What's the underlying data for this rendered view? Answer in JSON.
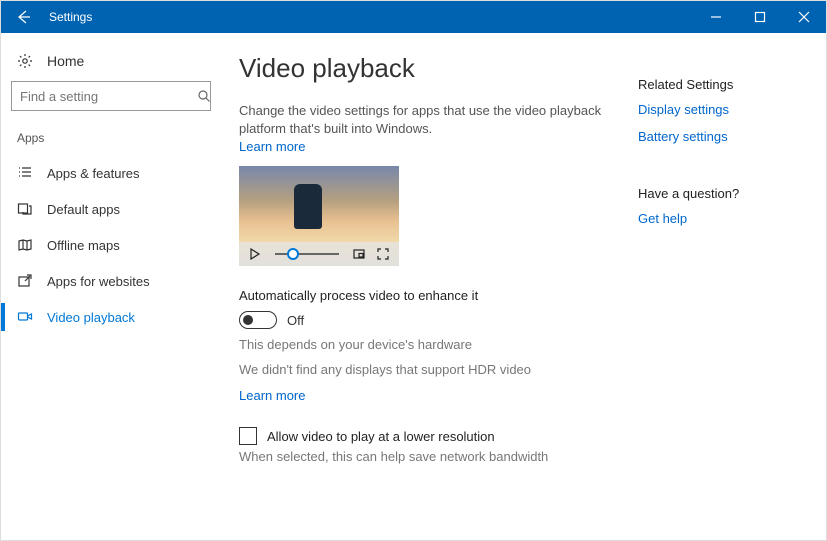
{
  "window": {
    "title": "Settings"
  },
  "sidebar": {
    "home": "Home",
    "search_placeholder": "Find a setting",
    "section": "Apps",
    "items": [
      {
        "label": "Apps & features"
      },
      {
        "label": "Default apps"
      },
      {
        "label": "Offline maps"
      },
      {
        "label": "Apps for websites"
      },
      {
        "label": "Video playback"
      }
    ]
  },
  "main": {
    "title": "Video playback",
    "description": "Change the video settings for apps that use the video playback platform that's built into Windows.",
    "learn_more": "Learn more",
    "auto_process_heading": "Automatically process video to enhance it",
    "toggle_state": "Off",
    "hardware_hint": "This depends on your device's hardware",
    "hdr_hint": "We didn't find any displays that support HDR video",
    "learn_more2": "Learn more",
    "lower_res_label": "Allow video to play at a lower resolution",
    "lower_res_hint": "When selected, this can help save network bandwidth"
  },
  "aside": {
    "related_heading": "Related Settings",
    "display_link": "Display settings",
    "battery_link": "Battery settings",
    "question_heading": "Have a question?",
    "help_link": "Get help"
  }
}
